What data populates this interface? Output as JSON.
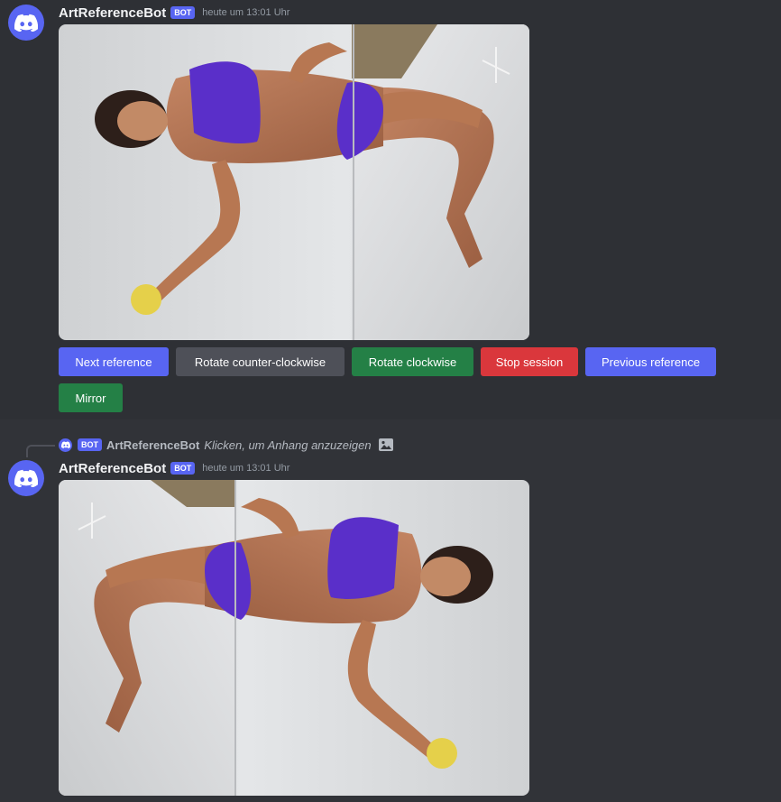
{
  "messages": [
    {
      "username": "ArtReferenceBot",
      "bot_tag": "BOT",
      "timestamp": "heute um 13:01 Uhr",
      "avatar_icon": "discord-logo-icon",
      "attachment": "reference-photo-rotated-counter-clockwise",
      "buttons": [
        {
          "label": "Next reference",
          "style": "primary"
        },
        {
          "label": "Rotate counter-clockwise",
          "style": "secondary"
        },
        {
          "label": "Rotate clockwise",
          "style": "success"
        },
        {
          "label": "Stop session",
          "style": "danger"
        },
        {
          "label": "Previous reference",
          "style": "primary"
        },
        {
          "label": "Mirror",
          "style": "success"
        }
      ]
    },
    {
      "reply": {
        "bot_tag": "BOT",
        "username": "ArtReferenceBot",
        "text": "Klicken, um Anhang anzuzeigen",
        "icon": "image-icon"
      },
      "username": "ArtReferenceBot",
      "bot_tag": "BOT",
      "timestamp": "heute um 13:01 Uhr",
      "avatar_icon": "discord-logo-icon",
      "attachment": "reference-photo-rotated-clockwise"
    }
  ],
  "colors": {
    "blurple": "#5865f2",
    "secondary": "#4e5058",
    "success": "#248046",
    "danger": "#da373c",
    "background": "#313338"
  }
}
